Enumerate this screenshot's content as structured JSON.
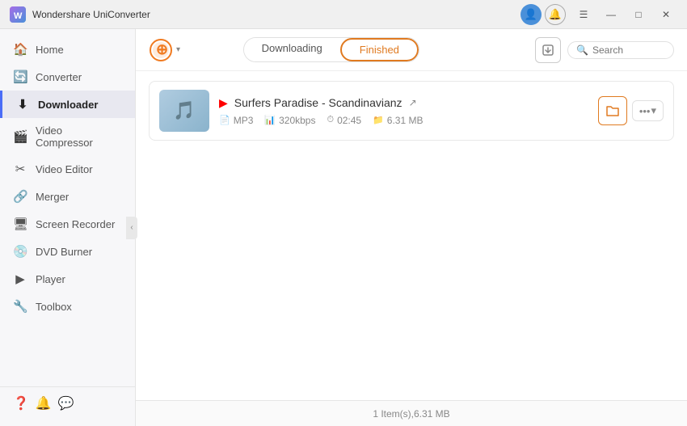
{
  "app": {
    "title": "Wondershare UniConverter",
    "logo_color": "#7b5ea7"
  },
  "titlebar": {
    "title": "Wondershare UniConverter",
    "controls": {
      "minimize": "—",
      "maximize": "□",
      "close": "✕"
    }
  },
  "sidebar": {
    "items": [
      {
        "id": "home",
        "label": "Home",
        "icon": "🏠",
        "active": false
      },
      {
        "id": "converter",
        "label": "Converter",
        "icon": "🔄",
        "active": false
      },
      {
        "id": "downloader",
        "label": "Downloader",
        "icon": "⬇",
        "active": true
      },
      {
        "id": "video-compressor",
        "label": "Video Compressor",
        "icon": "🎬",
        "active": false
      },
      {
        "id": "video-editor",
        "label": "Video Editor",
        "icon": "✂",
        "active": false
      },
      {
        "id": "merger",
        "label": "Merger",
        "icon": "🔗",
        "active": false
      },
      {
        "id": "screen-recorder",
        "label": "Screen Recorder",
        "icon": "🖥",
        "active": false
      },
      {
        "id": "dvd-burner",
        "label": "DVD Burner",
        "icon": "💿",
        "active": false
      },
      {
        "id": "player",
        "label": "Player",
        "icon": "▶",
        "active": false
      },
      {
        "id": "toolbox",
        "label": "Toolbox",
        "icon": "🔧",
        "active": false
      }
    ],
    "footer_icons": [
      "❓",
      "🔔",
      "💬"
    ]
  },
  "content_header": {
    "add_button_icon": "⊕",
    "tabs": [
      {
        "id": "downloading",
        "label": "Downloading",
        "active": false
      },
      {
        "id": "finished",
        "label": "Finished",
        "active": true
      }
    ],
    "search_placeholder": "Search"
  },
  "file_list": [
    {
      "id": "file-1",
      "title": "Surfers Paradise - Scandinavianz",
      "format": "MP3",
      "bitrate": "320kbps",
      "duration": "02:45",
      "size": "6.31 MB"
    }
  ],
  "status_bar": {
    "text": "1 Item(s),6.31 MB"
  }
}
